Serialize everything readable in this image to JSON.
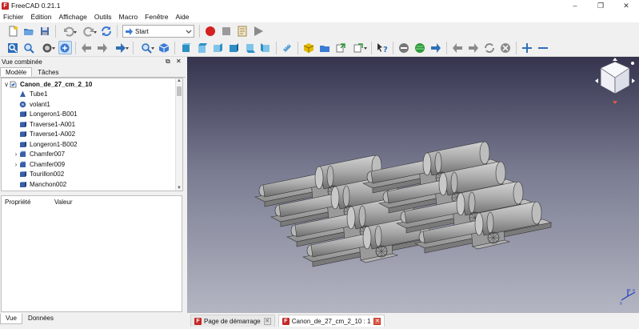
{
  "window": {
    "title": "FreeCAD 0.21.1",
    "controls": {
      "minimize": "–",
      "maximize": "❐",
      "close": "✕"
    }
  },
  "menu": [
    "Fichier",
    "Édition",
    "Affichage",
    "Outils",
    "Macro",
    "Fenêtre",
    "Aide"
  ],
  "workbench": {
    "label": "Start"
  },
  "combo_view": {
    "title": "Vue combinée",
    "tabs": [
      "Modèle",
      "Tâches"
    ],
    "tree": [
      {
        "label": "Canon_de_27_cm_2_10",
        "icon": "document-icon",
        "expand": "∨",
        "bold": true
      },
      {
        "label": "Tube1",
        "icon": "cone-icon"
      },
      {
        "label": "volant1",
        "icon": "part-icon"
      },
      {
        "label": "Longeron1-B001",
        "icon": "solid-icon"
      },
      {
        "label": "Traverse1-A001",
        "icon": "solid-icon"
      },
      {
        "label": "Traverse1-A002",
        "icon": "solid-icon"
      },
      {
        "label": "Longeron1-B002",
        "icon": "solid-icon"
      },
      {
        "label": "Chamfer007",
        "icon": "chamfer-icon",
        "expand": "›"
      },
      {
        "label": "Chamfer009",
        "icon": "chamfer-icon",
        "expand": "›"
      },
      {
        "label": "Tourillon002",
        "icon": "solid-icon"
      },
      {
        "label": "Manchon002",
        "icon": "solid-icon"
      }
    ],
    "property_headers": [
      "Propriété",
      "Valeur"
    ],
    "bottom_tabs": [
      "Vue",
      "Données"
    ]
  },
  "doc_tabs": [
    {
      "label": "Page de démarrage",
      "selected": false
    },
    {
      "label": "Canon_de_27_cm_2_10 : 1",
      "selected": true
    }
  ],
  "colors": {
    "accent": "#c62828",
    "viewport_top": "#34344e",
    "viewport_bottom": "#b4b6c3",
    "model_grey": "#b8b8b8"
  }
}
